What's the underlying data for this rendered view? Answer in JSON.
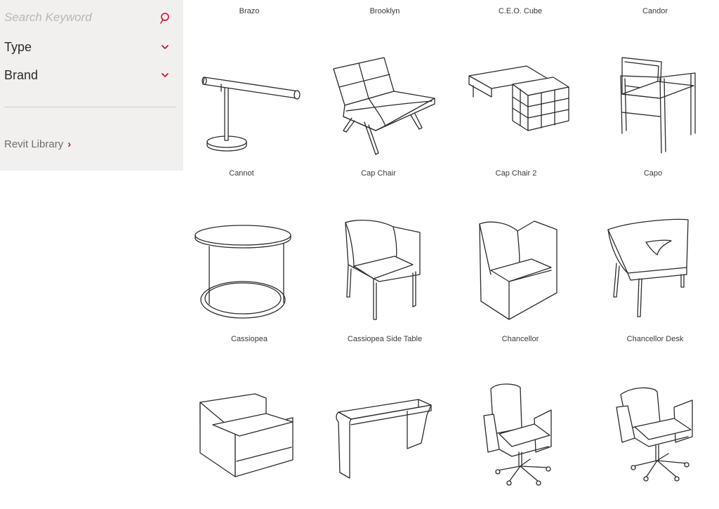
{
  "sidebar": {
    "search_placeholder": "Search Keyword",
    "filters": [
      {
        "label": "Type"
      },
      {
        "label": "Brand"
      }
    ],
    "revit_link": "Revit Library",
    "revit_arrow": "›",
    "accent_color": "#d2122e"
  },
  "grid": {
    "top_captions": [
      "Brazo",
      "Brooklyn",
      "C.E.O. Cube",
      "Candor"
    ],
    "row1_captions": [
      "Cannot",
      "Cap Chair",
      "Cap Chair 2",
      "Capo"
    ],
    "row2_captions": [
      "Cassiopea",
      "Cassiopea Side Table",
      "Chancellor",
      "Chancellor Desk"
    ],
    "row1_icons": [
      "desk-lamp-icon",
      "lounge-bench-icon",
      "cube-desk-icon",
      "armchair-icon"
    ],
    "row2_icons": [
      "round-side-table-icon",
      "tub-armchair-icon",
      "tub-chair-icon",
      "shell-chair-icon"
    ],
    "row3_icons": [
      "lounge-sofa-icon",
      "writing-desk-icon",
      "swivel-office-chair-icon",
      "swivel-lounge-chair-icon"
    ]
  }
}
